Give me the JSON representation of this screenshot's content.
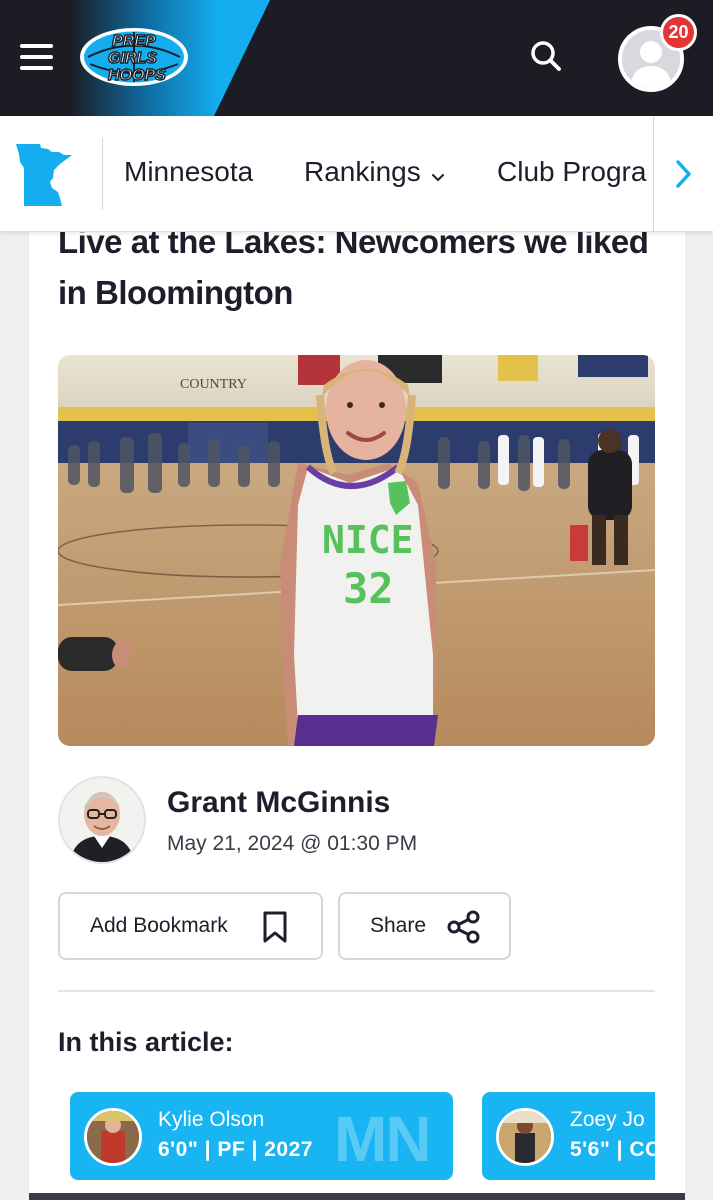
{
  "header": {
    "logo_lines": [
      "PREP",
      "GIRLS",
      "HOOPS"
    ],
    "notification_count": "20",
    "icons": [
      "menu-icon",
      "search-icon",
      "user-avatar-icon"
    ],
    "accent_color": "#14aef0",
    "badge_color": "#e53434"
  },
  "nav": {
    "state_label": "Minnesota",
    "rankings_label": "Rankings",
    "club_label": "Club Progra",
    "next_icon": "chevron-right-icon"
  },
  "article": {
    "title": "Live at the Lakes: Newcomers we liked in Bloomington",
    "photo": {
      "jersey_text": "NICE",
      "jersey_number": "32",
      "gym_sign": "COUNTRY"
    },
    "author_name": "Grant McGinnis",
    "date": "May 21, 2024 @ 01:30 PM",
    "bookmark_label": "Add Bookmark",
    "share_label": "Share",
    "in_this_article_label": "In this article:"
  },
  "players": [
    {
      "name": "Kylie Olson",
      "info": "6'0\" | PF | 2027",
      "state": "MN"
    },
    {
      "name": "Zoey Jo",
      "info": "5'6\" | CC",
      "state": ""
    }
  ]
}
